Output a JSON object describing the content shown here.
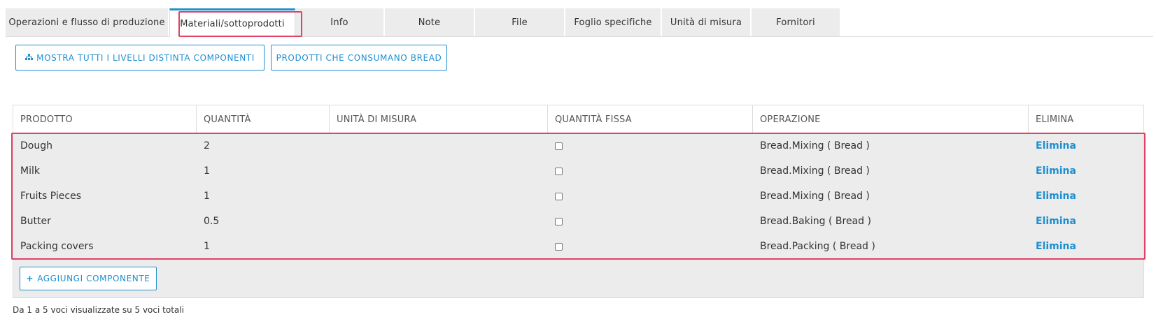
{
  "tabs": [
    {
      "label": "Operazioni e flusso di produzione"
    },
    {
      "label": "Materiali/sottoprodotti"
    },
    {
      "label": "Info"
    },
    {
      "label": "Note"
    },
    {
      "label": "File"
    },
    {
      "label": "Foglio specifiche"
    },
    {
      "label": "Unità di misura"
    },
    {
      "label": "Fornitori"
    }
  ],
  "actions": {
    "levels_label": "MOSTRA TUTTI I LIVELLI DISTINTA COMPONENTI",
    "levels_icon": "sitemap-icon",
    "consume_label": "PRODOTTI CHE CONSUMANO BREAD",
    "add_label": "AGGIUNGI COMPONENTE",
    "add_icon": "plus-icon"
  },
  "table": {
    "headers": {
      "product": "PRODOTTO",
      "quantity": "QUANTITÀ",
      "uom": "UNITÀ DI MISURA",
      "fixed_qty": "QUANTITÀ FISSA",
      "operation": "OPERAZIONE",
      "delete": "ELIMINA"
    },
    "rows": [
      {
        "product": "Dough",
        "quantity": "2",
        "uom": "",
        "fixed": false,
        "operation": "Bread.Mixing ( Bread )",
        "delete": "Elimina"
      },
      {
        "product": "Milk",
        "quantity": "1",
        "uom": "",
        "fixed": false,
        "operation": "Bread.Mixing ( Bread )",
        "delete": "Elimina"
      },
      {
        "product": "Fruits Pieces",
        "quantity": "1",
        "uom": "",
        "fixed": false,
        "operation": "Bread.Mixing ( Bread )",
        "delete": "Elimina"
      },
      {
        "product": "Butter",
        "quantity": "0.5",
        "uom": "",
        "fixed": false,
        "operation": "Bread.Baking ( Bread )",
        "delete": "Elimina"
      },
      {
        "product": "Packing covers",
        "quantity": "1",
        "uom": "",
        "fixed": false,
        "operation": "Bread.Packing ( Bread )",
        "delete": "Elimina"
      }
    ]
  },
  "footer": {
    "summary": "Da 1 a 5 voci visualizzate su 5 voci totali"
  },
  "colors": {
    "accent": "#1e8fd1",
    "highlight": "#e0406a",
    "row_bg": "#ececec"
  }
}
